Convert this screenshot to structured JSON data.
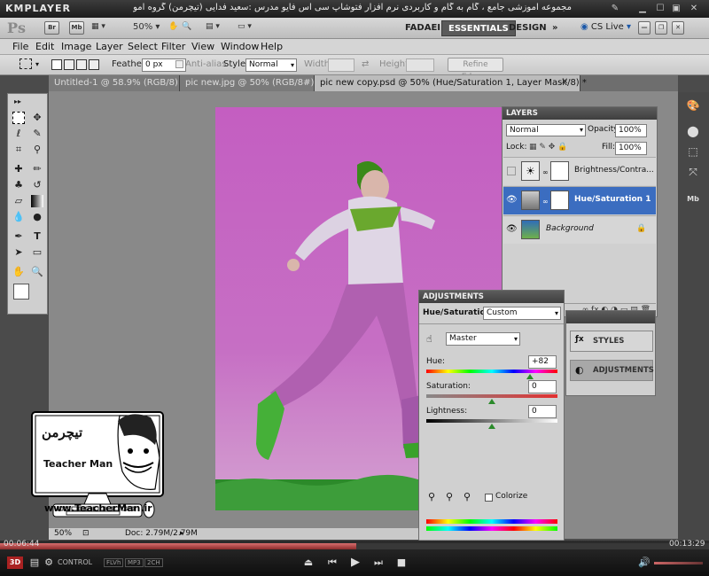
{
  "player": {
    "logo": "KMPLAYER",
    "title": "مجموعه آموزشی جامع ، گام به گام و کاربردی نرم افزار فتوشاپ سی اس فایو  مدرس :سعید فدایی (تیچرمن) گروه آموزشی پادشاه گرافیست ها",
    "time_current": "00:06:44",
    "time_total": "00:13:29",
    "progress": 0.503,
    "badges": [
      "3D",
      "FLVh",
      "MP3",
      "2CH"
    ]
  },
  "appbar": {
    "logo": "Ps",
    "bridge": "Br",
    "minibridge": "Mb",
    "zoom": "50%",
    "workspaces": [
      "FADAEI",
      "ESSENTIALS",
      "DESIGN"
    ],
    "active_workspace": "ESSENTIALS",
    "cs_live": "CS Live"
  },
  "menu": [
    "File",
    "Edit",
    "Image",
    "Layer",
    "Select",
    "Filter",
    "View",
    "Window",
    "Help"
  ],
  "options": {
    "feather_label": "Feather:",
    "feather_value": "0 px",
    "antialias_label": "Anti-alias",
    "style_label": "Style:",
    "style_value": "Normal",
    "width_label": "Width:",
    "height_label": "Height:",
    "refine_label": "Refine Edge..."
  },
  "tabs": [
    {
      "label": "Untitled-1 @ 58.9% (RGB/8)",
      "active": false
    },
    {
      "label": "pic new.jpg @ 50% (RGB/8#)",
      "active": false
    },
    {
      "label": "pic new copy.psd @ 50% (Hue/Saturation 1, Layer Mask/8) *",
      "active": true
    }
  ],
  "status": {
    "zoom": "50%",
    "doc": "Doc: 2.79M/2.79M"
  },
  "layers": {
    "title": "LAYERS",
    "blend_mode": "Normal",
    "opacity_label": "Opacity:",
    "opacity_value": "100%",
    "lock_label": "Lock:",
    "fill_label": "Fill:",
    "fill_value": "100%",
    "items": [
      {
        "name": "Brightness/Contra...",
        "visible": false
      },
      {
        "name": "Hue/Saturation 1",
        "visible": true,
        "selected": true
      },
      {
        "name": "Background",
        "visible": true
      }
    ]
  },
  "adjustments": {
    "title": "ADJUSTMENTS",
    "type_label": "Hue/Saturation",
    "preset": "Custom",
    "channel": "Master",
    "hue_label": "Hue:",
    "hue_value": "+82",
    "saturation_label": "Saturation:",
    "saturation_value": "0",
    "lightness_label": "Lightness:",
    "lightness_value": "0",
    "colorize_label": "Colorize"
  },
  "side_panels": {
    "styles": "STYLES",
    "adjustments": "ADJUSTMENTS"
  },
  "watermark": {
    "brand": "Teacher Man",
    "url": "www.TeacherMan.ir",
    "persian": "تیچرمن"
  }
}
